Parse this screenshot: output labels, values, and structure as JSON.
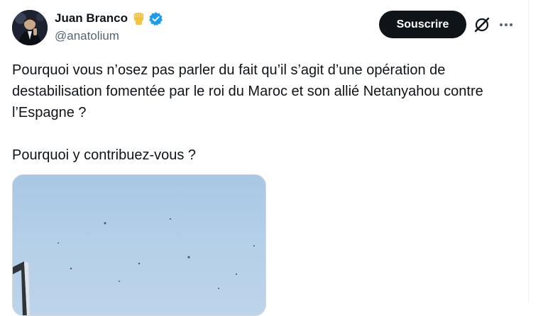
{
  "tweet": {
    "author": {
      "name": "Juan Branco",
      "handle": "@anatolium",
      "emoji_icon": "raised-fist-emoji",
      "verified_icon": "verified-badge-icon",
      "verified_color": "#1d9bf0"
    },
    "actions": {
      "subscribe_label": "Souscrire",
      "grok_icon": "grok-icon",
      "more_icon": "more-horizontal-icon"
    },
    "text": {
      "line1": "Pourquoi vous n’osez pas parler du fait qu’il s’agit d’une opération de destabilisation fomentée par le roi du Maroc et son allié Netanyahou contre l’Espagne ?",
      "line2": "Pourquoi y contribuez-vous ?"
    },
    "media": {
      "type": "video-thumbnail"
    }
  }
}
